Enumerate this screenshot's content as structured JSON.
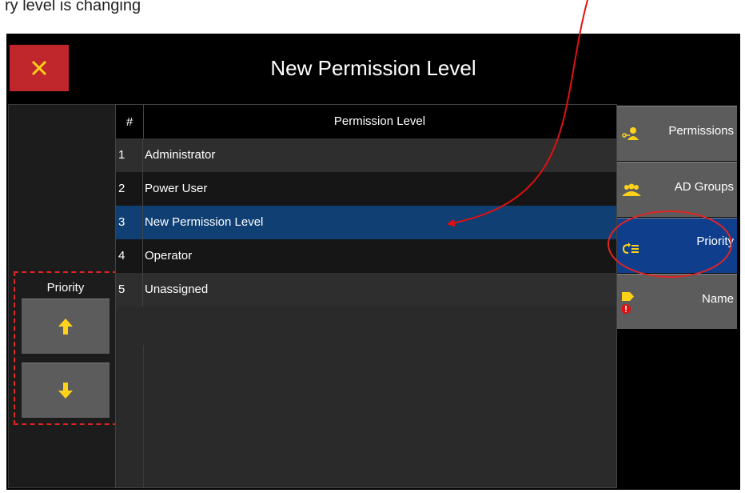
{
  "caption": "ry level is changing",
  "window": {
    "title": "New Permission Level"
  },
  "priority_panel": {
    "label": "Priority"
  },
  "table": {
    "headers": [
      "#",
      "Permission Level"
    ],
    "rows": [
      {
        "num": "1",
        "level": "Administrator"
      },
      {
        "num": "2",
        "level": "Power User"
      },
      {
        "num": "3",
        "level": "New Permission Level",
        "selected": true
      },
      {
        "num": "4",
        "level": "Operator"
      },
      {
        "num": "5",
        "level": "Unassigned"
      }
    ]
  },
  "side_nav": {
    "items": [
      {
        "label": "Permissions",
        "icon": "user-key-icon"
      },
      {
        "label": "AD Groups",
        "icon": "user-group-icon"
      },
      {
        "label": "Priority",
        "icon": "priority-order-icon",
        "active": true
      },
      {
        "label": "Name",
        "icon": "tag-warning-icon"
      }
    ]
  },
  "colors": {
    "accent_yellow": "#ffd21a",
    "close_red": "#c0272d",
    "selected_blue": "#0f3f73",
    "active_nav": "#0f3f8c",
    "annotation_red": "#e02424"
  }
}
